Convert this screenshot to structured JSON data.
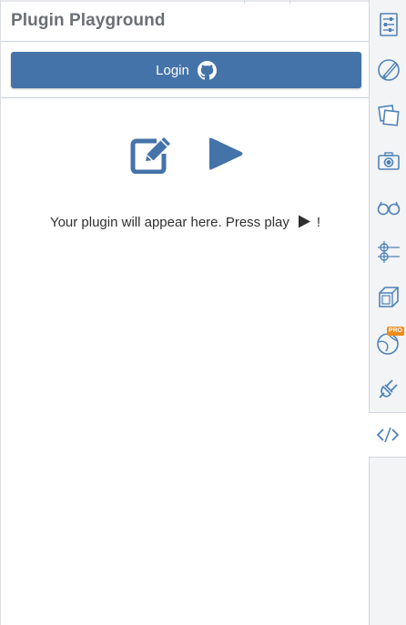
{
  "header": {
    "title": "Plugin Playground"
  },
  "login": {
    "label": "Login",
    "icon": "github-icon"
  },
  "toolbar": {
    "edit_icon": "edit-icon",
    "play_icon": "play-icon"
  },
  "message": {
    "before": "Your plugin will appear here. Press play",
    "after": "!"
  },
  "sidebar": {
    "items": [
      {
        "name": "properties-icon"
      },
      {
        "name": "style-icon"
      },
      {
        "name": "layers-icon"
      },
      {
        "name": "camera-icon"
      },
      {
        "name": "glasses-icon"
      },
      {
        "name": "constraints-icon"
      },
      {
        "name": "3d-view-icon"
      },
      {
        "name": "globe-pro-icon",
        "badge": "PRO"
      },
      {
        "name": "plugin-plug-icon"
      },
      {
        "name": "code-icon",
        "active": true
      }
    ]
  },
  "colors": {
    "accent": "#4473a9",
    "title": "#6b6f75",
    "sidebar_icon": "#4f82b8",
    "pro_badge": "#ef8a1c"
  }
}
